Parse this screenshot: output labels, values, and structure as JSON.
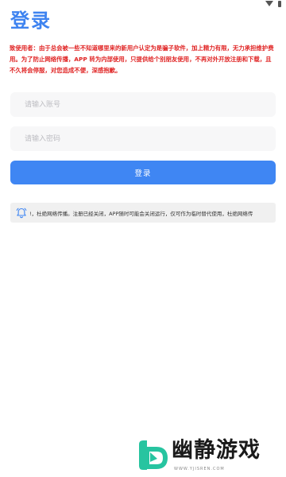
{
  "page": {
    "title": "登录",
    "notice": "致使用者：由于总会被一些不知道哪里来的新用户认定为是骗子软件，加上精力有限，无力承担维护费用。为了防止网络传播，APP 转为内部使用，只提供给个别朋友使用，不再对外开放注册和下载，且不久将会停服，对您造成不便，深感抱歉。"
  },
  "form": {
    "account_placeholder": "请输入账号",
    "password_placeholder": "请输入密码",
    "login_label": "登录"
  },
  "announcement": {
    "icon": "bell-icon",
    "text": "!，杜绝网络传播。注册已经关闭，APP随时可能会关闭运行，仅可作为临时替代使用，杜绝网络传"
  },
  "watermark": {
    "brand": "幽静游戏",
    "url": "WWW.YJISREN.COM"
  },
  "colors": {
    "accent": "#3f86f3",
    "notice": "#e02424",
    "watermark_logo": "#27c4a0"
  }
}
